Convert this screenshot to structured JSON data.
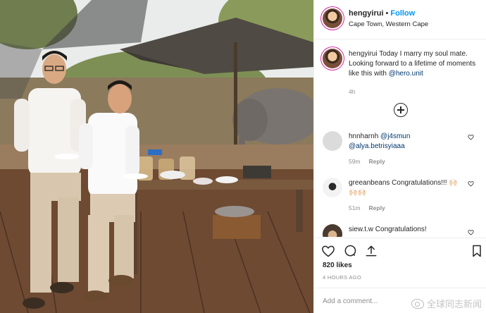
{
  "post": {
    "username": "hengyirui",
    "separator": "•",
    "follow_label": "Follow",
    "location": "Cape Town, Western Cape"
  },
  "caption": {
    "username": "hengyirui",
    "text_before": " Today I marry my soul mate. Looking forward to a lifetime of moments like this with ",
    "mention": "@hero.unit",
    "time": "4h"
  },
  "comments": [
    {
      "username": "hnnharnh",
      "mention_1": "@j4smun",
      "mention_2": "@alya.betrisyiaaa",
      "age": "59m",
      "reply_label": "Reply"
    },
    {
      "username": "greeanbeans",
      "text": " Congratulations!!! 🙌🏻🙌🏻🙌🏻",
      "age": "51m",
      "reply_label": "Reply"
    },
    {
      "username": "siew.t.w",
      "text": " Congratulations!"
    }
  ],
  "likes_label": "820 likes",
  "post_time": "4 HOURS AGO",
  "add_comment_placeholder": "Add a comment...",
  "watermark": "全球同志新闻",
  "icons": {
    "load_more": "plus-circle-icon",
    "like": "heart-icon",
    "comment": "comment-icon",
    "share": "share-icon",
    "save": "bookmark-icon"
  },
  "colors": {
    "link": "#0095f6",
    "mention": "#00376b",
    "muted": "#8e8e8e",
    "text": "#262626"
  }
}
